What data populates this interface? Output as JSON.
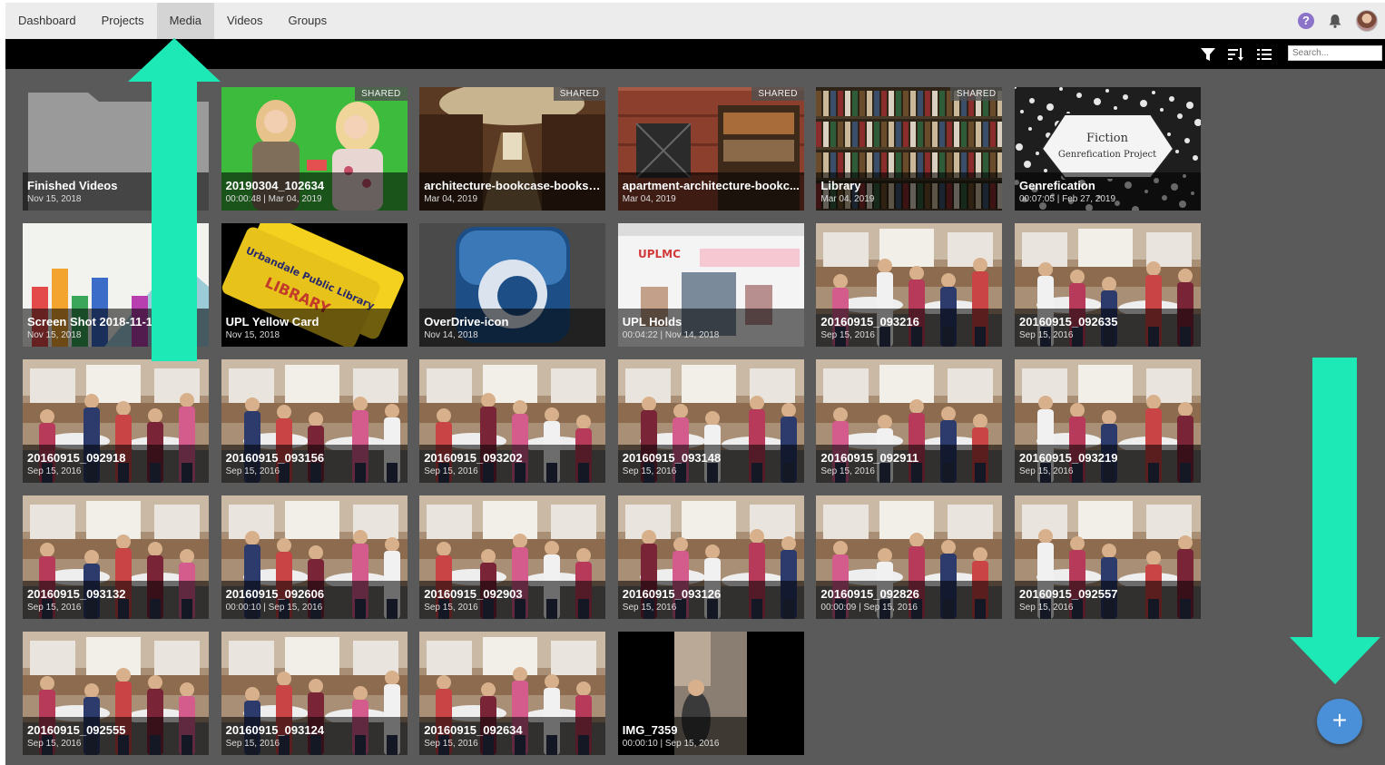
{
  "nav": {
    "items": [
      {
        "label": "Dashboard",
        "active": false
      },
      {
        "label": "Projects",
        "active": false
      },
      {
        "label": "Media",
        "active": true
      },
      {
        "label": "Videos",
        "active": false
      },
      {
        "label": "Groups",
        "active": false
      }
    ],
    "help_label": "?"
  },
  "toolbar": {
    "icons": [
      "filter-icon",
      "sort-icon",
      "list-view-icon"
    ],
    "search_placeholder": "Search..."
  },
  "colors": {
    "accent_arrow": "#1de9b6",
    "fab": "#4a90d9",
    "help": "#8a73c9"
  },
  "media": [
    {
      "title": "Finished Videos",
      "meta": "Nov 15, 2018",
      "shared": "",
      "kind": "folder"
    },
    {
      "title": "20190304_102634",
      "meta": "00:00:48 | Mar 04, 2019",
      "shared": "SHARED",
      "kind": "greenscreen"
    },
    {
      "title": "architecture-bookcase-books-...",
      "meta": "Mar 04, 2019",
      "shared": "SHARED",
      "kind": "library"
    },
    {
      "title": "apartment-architecture-bookc...",
      "meta": "Mar 04, 2019",
      "shared": "SHARED",
      "kind": "brick"
    },
    {
      "title": "Library",
      "meta": "Mar 04, 2019",
      "shared": "SHARED",
      "kind": "shelves"
    },
    {
      "title": "Genrefication",
      "meta": "00:07:05 | Feb 27, 2019",
      "shared": "",
      "kind": "notebook",
      "art_text": [
        "Fiction",
        "Genrefication Project"
      ]
    },
    {
      "title": "Screen Shot 2018-11-15",
      "meta": "Nov 15, 2018",
      "shared": "",
      "kind": "colorful"
    },
    {
      "title": "UPL Yellow Card",
      "meta": "Nov 15, 2018",
      "shared": "",
      "kind": "yellowcard",
      "art_text": [
        "Urbandale Public Library",
        "LIBRARY"
      ]
    },
    {
      "title": "OverDrive-icon",
      "meta": "Nov 14, 2018",
      "shared": "",
      "kind": "overdrive"
    },
    {
      "title": "UPL Holds",
      "meta": "00:04:22 | Nov 14, 2018",
      "shared": "",
      "kind": "webpage",
      "art_text": [
        "UPLMC"
      ]
    },
    {
      "title": "20160915_093216",
      "meta": "Sep 15, 2016",
      "shared": "",
      "kind": "room"
    },
    {
      "title": "20160915_092635",
      "meta": "Sep 15, 2016",
      "shared": "",
      "kind": "room"
    },
    {
      "title": "20160915_092918",
      "meta": "Sep 15, 2016",
      "shared": "",
      "kind": "room"
    },
    {
      "title": "20160915_093156",
      "meta": "Sep 15, 2016",
      "shared": "",
      "kind": "room"
    },
    {
      "title": "20160915_093202",
      "meta": "Sep 15, 2016",
      "shared": "",
      "kind": "room"
    },
    {
      "title": "20160915_093148",
      "meta": "Sep 15, 2016",
      "shared": "",
      "kind": "room"
    },
    {
      "title": "20160915_092911",
      "meta": "Sep 15, 2016",
      "shared": "",
      "kind": "room"
    },
    {
      "title": "20160915_093219",
      "meta": "Sep 15, 2016",
      "shared": "",
      "kind": "room"
    },
    {
      "title": "20160915_093132",
      "meta": "Sep 15, 2016",
      "shared": "",
      "kind": "room"
    },
    {
      "title": "20160915_092606",
      "meta": "00:00:10 | Sep 15, 2016",
      "shared": "",
      "kind": "room"
    },
    {
      "title": "20160915_092903",
      "meta": "Sep 15, 2016",
      "shared": "",
      "kind": "room"
    },
    {
      "title": "20160915_093126",
      "meta": "Sep 15, 2016",
      "shared": "",
      "kind": "room"
    },
    {
      "title": "20160915_092826",
      "meta": "00:00:09 | Sep 15, 2016",
      "shared": "",
      "kind": "room"
    },
    {
      "title": "20160915_092557",
      "meta": "Sep 15, 2016",
      "shared": "",
      "kind": "room"
    },
    {
      "title": "20160915_092555",
      "meta": "Sep 15, 2016",
      "shared": "",
      "kind": "room"
    },
    {
      "title": "20160915_093124",
      "meta": "Sep 15, 2016",
      "shared": "",
      "kind": "room"
    },
    {
      "title": "20160915_092634",
      "meta": "Sep 15, 2016",
      "shared": "",
      "kind": "room"
    },
    {
      "title": "IMG_7359",
      "meta": "00:00:10 | Sep 15, 2016",
      "shared": "",
      "kind": "portrait"
    }
  ],
  "fab_label": "+"
}
